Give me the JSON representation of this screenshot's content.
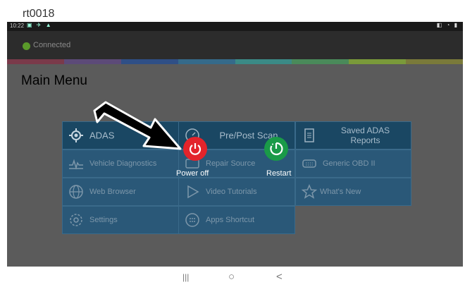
{
  "device": {
    "label": "rt0018"
  },
  "statusbar": {
    "time": "10:22",
    "sys_icons": "▣ ✈ ▲",
    "right_icons": "◧ ◔ ▮"
  },
  "connection": {
    "status": "Connected",
    "dot_color": "#5a9a2a"
  },
  "color_strip": [
    "#7a3a4a",
    "#5c4a78",
    "#2f4f86",
    "#356a8a",
    "#3b8a86",
    "#4a8a5a",
    "#7a9a3a",
    "#7a7a3a"
  ],
  "title": "Main Menu",
  "tiles": {
    "adas": {
      "label": "ADAS"
    },
    "pre_post_scan": {
      "label": "Pre/Post Scan"
    },
    "saved_adas_reports": {
      "label": "Saved ADAS\nReports"
    },
    "vehicle_diagnostics": {
      "label": "Vehicle Diagnostics"
    },
    "repair_source": {
      "label": "Repair Source"
    },
    "generic_obd": {
      "label": "Generic OBD II"
    },
    "web_browser": {
      "label": "Web Browser"
    },
    "video_tutorials": {
      "label": "Video Tutorials"
    },
    "whats_new": {
      "label": "What's New"
    },
    "settings": {
      "label": "Settings"
    },
    "apps_shortcut": {
      "label": "Apps Shortcut"
    }
  },
  "power_menu": {
    "power_off": {
      "label": "Power off",
      "color": "#e3242b"
    },
    "restart": {
      "label": "Restart",
      "color": "#1a9a48"
    }
  },
  "navbar": {
    "recents": "|||",
    "home": "○",
    "back": "<"
  }
}
